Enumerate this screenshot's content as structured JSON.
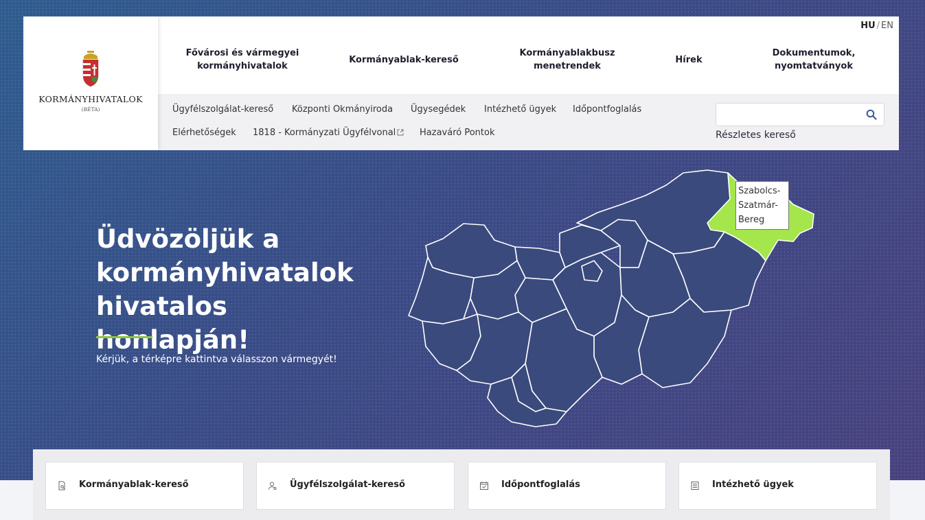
{
  "logo": {
    "name": "KORMÁNYHIVATALOK",
    "sub": "(BÉTA)"
  },
  "lang": {
    "hu": "HU",
    "sep": "/",
    "en": "EN"
  },
  "mainnav": [
    "Fővárosi és vármegyei kormányhivatalok",
    "Kormányablak-kereső",
    "Kormányablakbusz menetrendek",
    "Hírek",
    "Dokumentumok, nyomtatványok"
  ],
  "subnav": [
    "Ügyfélszolgálat-kereső",
    "Központi Okmányiroda",
    "Ügysegédek",
    "Intézhető ügyek",
    "Időpontfoglalás",
    "Elérhetőségek",
    "1818 - Kormányzati Ügyfélvonal",
    "Hazaváró Pontok"
  ],
  "search": {
    "placeholder": "",
    "detailed": "Részletes kereső"
  },
  "hero": {
    "title": "Üdvözöljük a kormányhivatalok hivatalos honlapján!",
    "subtitle": "Kérjük, a térképre kattintva válasszon vármegyét!"
  },
  "map": {
    "base_color": "#3a4a7d",
    "highlight_color": "#a4e64b",
    "tooltip_lines": [
      "Szabolcs-",
      "Szatmár-",
      "Bereg"
    ]
  },
  "quicklinks": [
    {
      "label": "Kormányablak-kereső",
      "icon": "search-doc-icon"
    },
    {
      "label": "Ügyfélszolgálat-kereső",
      "icon": "user-search-icon"
    },
    {
      "label": "Időpontfoglalás",
      "icon": "calendar-icon"
    },
    {
      "label": "Intézhető ügyek",
      "icon": "list-doc-icon"
    }
  ]
}
